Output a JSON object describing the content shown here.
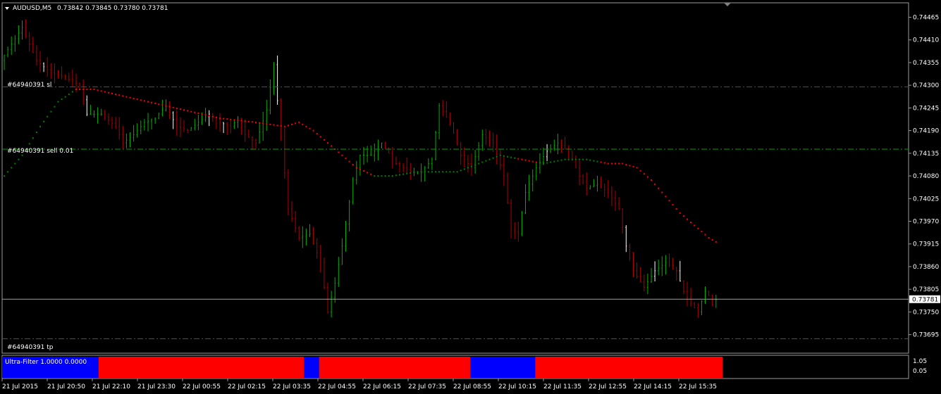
{
  "header": {
    "symbol": "AUDUSD,M5",
    "ohlc": "0.73842 0.73845 0.73780 0.73781"
  },
  "orders": {
    "sl_label": "#64940391 sl",
    "sl_price": 0.74296,
    "entry_label": "#64940391 sell 0.01",
    "entry_price": 0.74145,
    "tp_label": "#64940391 tp",
    "tp_price": 0.73685
  },
  "current_price": {
    "label": "0.73781",
    "value": 0.73781
  },
  "indicator": {
    "label": "Ultra-Filter 1.0000 0.0000",
    "scale_high": "1.05",
    "scale_low": "0.05",
    "segments": [
      {
        "color": "blue",
        "from": 0,
        "to": 0.134
      },
      {
        "color": "red",
        "from": 0.134,
        "to": 0.419
      },
      {
        "color": "blue",
        "from": 0.419,
        "to": 0.44
      },
      {
        "color": "red",
        "from": 0.44,
        "to": 0.65
      },
      {
        "color": "blue",
        "from": 0.65,
        "to": 0.74
      },
      {
        "color": "red",
        "from": 0.74,
        "to": 1.0
      }
    ]
  },
  "colors": {
    "background": "#000000",
    "bull": "#00b000",
    "bear": "#b00000",
    "doji": "#ffffff",
    "ma_up": "#008000",
    "ma_down": "#ff0000",
    "sl_tp_line": "#ff0000",
    "entry_line": "#00a000",
    "filter_blue": "#0000ff",
    "filter_red": "#ff0000"
  },
  "chart_data": {
    "type": "candlestick",
    "symbol": "AUDUSD",
    "timeframe": "M5",
    "ylim": [
      0.7365,
      0.745
    ],
    "y_ticks": [
      "0.74465",
      "0.74410",
      "0.74355",
      "0.74300",
      "0.74245",
      "0.74190",
      "0.74135",
      "0.74080",
      "0.74025",
      "0.73970",
      "0.73915",
      "0.73860",
      "0.73805",
      "0.73750",
      "0.73695"
    ],
    "x_ticks": [
      "21 Jul 2015",
      "21 Jul 20:50",
      "21 Jul 22:10",
      "21 Jul 23:30",
      "22 Jul 00:55",
      "22 Jul 02:15",
      "22 Jul 03:35",
      "22 Jul 04:55",
      "22 Jul 06:15",
      "22 Jul 07:35",
      "22 Jul 08:55",
      "22 Jul 10:15",
      "22 Jul 11:35",
      "22 Jul 12:55",
      "22 Jul 14:15",
      "22 Jul 15:35"
    ],
    "price_path": [
      [
        0,
        0.7436
      ],
      [
        3,
        0.744
      ],
      [
        6,
        0.7444
      ],
      [
        10,
        0.7436
      ],
      [
        14,
        0.7433
      ],
      [
        18,
        0.7432
      ],
      [
        22,
        0.743
      ],
      [
        24,
        0.7423
      ],
      [
        28,
        0.7423
      ],
      [
        32,
        0.742
      ],
      [
        34,
        0.7416
      ],
      [
        37,
        0.7418
      ],
      [
        40,
        0.7421
      ],
      [
        43,
        0.7422
      ],
      [
        46,
        0.7425
      ],
      [
        49,
        0.742
      ],
      [
        52,
        0.7419
      ],
      [
        55,
        0.7421
      ],
      [
        58,
        0.7423
      ],
      [
        61,
        0.7421
      ],
      [
        64,
        0.742
      ],
      [
        66,
        0.7422
      ],
      [
        68,
        0.7418
      ],
      [
        71,
        0.7416
      ],
      [
        74,
        0.7424
      ],
      [
        76,
        0.7435
      ],
      [
        80,
        0.74
      ],
      [
        83,
        0.7393
      ],
      [
        86,
        0.7394
      ],
      [
        89,
        0.7387
      ],
      [
        91,
        0.7375
      ],
      [
        93,
        0.7382
      ],
      [
        95,
        0.7391
      ],
      [
        98,
        0.7407
      ],
      [
        100,
        0.7413
      ],
      [
        103,
        0.7413
      ],
      [
        106,
        0.7416
      ],
      [
        110,
        0.7411
      ],
      [
        114,
        0.7409
      ],
      [
        117,
        0.7409
      ],
      [
        120,
        0.7412
      ],
      [
        122,
        0.7425
      ],
      [
        125,
        0.7421
      ],
      [
        128,
        0.7413
      ],
      [
        131,
        0.741
      ],
      [
        134,
        0.7418
      ],
      [
        137,
        0.7416
      ],
      [
        140,
        0.7408
      ],
      [
        142,
        0.7395
      ],
      [
        144,
        0.7394
      ],
      [
        146,
        0.7404
      ],
      [
        149,
        0.741
      ],
      [
        152,
        0.7414
      ],
      [
        155,
        0.7416
      ],
      [
        158,
        0.7414
      ],
      [
        161,
        0.7408
      ],
      [
        163,
        0.7405
      ],
      [
        166,
        0.7406
      ],
      [
        169,
        0.7404
      ],
      [
        172,
        0.74
      ],
      [
        174,
        0.7391
      ],
      [
        176,
        0.7385
      ],
      [
        179,
        0.7381
      ],
      [
        182,
        0.7385
      ],
      [
        185,
        0.7387
      ],
      [
        188,
        0.7385
      ],
      [
        190,
        0.738
      ],
      [
        192,
        0.7377
      ],
      [
        194,
        0.7375
      ],
      [
        196,
        0.738
      ],
      [
        198,
        0.7378
      ]
    ],
    "ma_path": [
      [
        0,
        0.7408
      ],
      [
        5,
        0.7413
      ],
      [
        10,
        0.742
      ],
      [
        15,
        0.7426
      ],
      [
        20,
        0.7429
      ],
      [
        25,
        0.7429
      ],
      [
        30,
        0.7428
      ],
      [
        40,
        0.7426
      ],
      [
        50,
        0.7424
      ],
      [
        60,
        0.7422
      ],
      [
        70,
        0.7421
      ],
      [
        78,
        0.742
      ],
      [
        82,
        0.7421
      ],
      [
        86,
        0.7419
      ],
      [
        90,
        0.7416
      ],
      [
        94,
        0.7413
      ],
      [
        98,
        0.741
      ],
      [
        103,
        0.7408
      ],
      [
        108,
        0.7408
      ],
      [
        115,
        0.7409
      ],
      [
        121,
        0.7409
      ],
      [
        126,
        0.7409
      ],
      [
        132,
        0.7411
      ],
      [
        138,
        0.7413
      ],
      [
        144,
        0.7412
      ],
      [
        150,
        0.7411
      ],
      [
        156,
        0.7412
      ],
      [
        162,
        0.7412
      ],
      [
        168,
        0.7411
      ],
      [
        172,
        0.7411
      ],
      [
        176,
        0.741
      ],
      [
        180,
        0.7407
      ],
      [
        184,
        0.7403
      ],
      [
        188,
        0.7399
      ],
      [
        192,
        0.7396
      ],
      [
        196,
        0.7393
      ],
      [
        198,
        0.7392
      ]
    ],
    "ma_color_switches": [
      [
        0,
        "up"
      ],
      [
        20,
        "down"
      ],
      [
        82,
        "down"
      ],
      [
        103,
        "up"
      ],
      [
        143,
        "down"
      ],
      [
        149,
        "up"
      ],
      [
        166,
        "down"
      ]
    ],
    "doji_marks": [
      11,
      23,
      47,
      57,
      61,
      76,
      151,
      173,
      181,
      188
    ]
  }
}
